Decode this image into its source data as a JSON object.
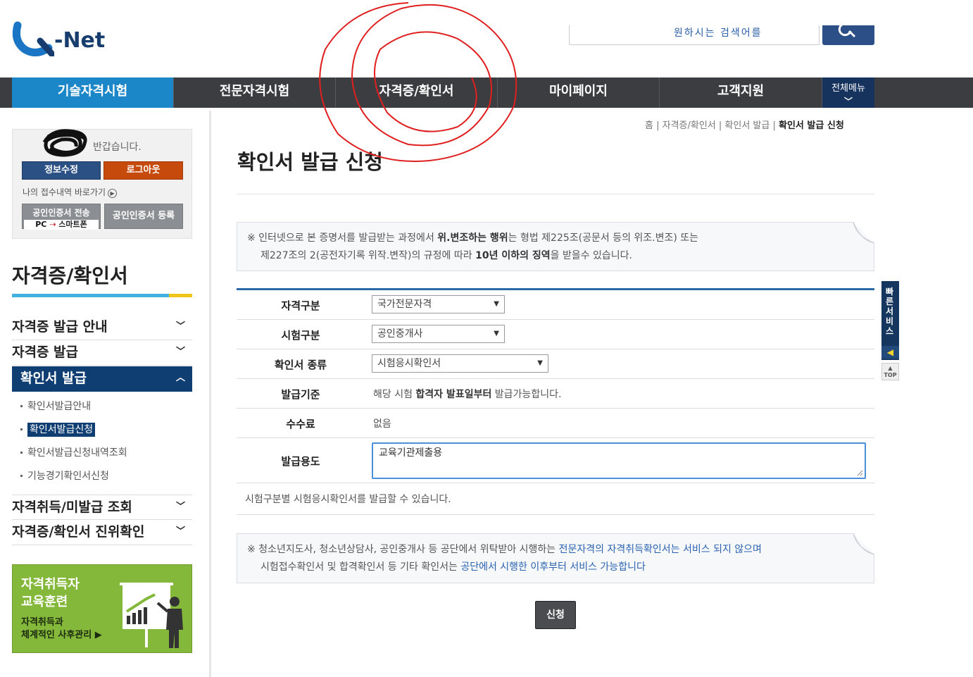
{
  "header": {
    "logo_text": "-Net",
    "search_value": "원하시는 검색어를",
    "gnb": [
      {
        "label": "기술자격시험"
      },
      {
        "label": "전문자격시험"
      },
      {
        "label": "자격증/확인서"
      },
      {
        "label": "마이페이지"
      },
      {
        "label": "고객지원"
      }
    ],
    "all_menu": "전체메뉴"
  },
  "login": {
    "greeting": "반갑습니다.",
    "edit_btn": "정보수정",
    "logout_btn": "로그아웃",
    "my_link": "나의 접수내역 바로가기",
    "cert_transfer_l1": "공인인증서 전송",
    "cert_transfer_pc": "PC",
    "cert_transfer_phone": "스마트폰",
    "cert_register": "공인인증서 등록"
  },
  "lnb": {
    "title": "자격증/확인서",
    "items": [
      {
        "label": "자격증 발급 안내"
      },
      {
        "label": "자격증 발급"
      },
      {
        "label": "확인서 발급"
      },
      {
        "label": "자격취득/미발급 조회"
      },
      {
        "label": "자격증/확인서 진위확인"
      }
    ],
    "sub": [
      {
        "label": "확인서발급안내"
      },
      {
        "label": "확인서발급신청"
      },
      {
        "label": "확인서발급신청내역조회"
      },
      {
        "label": "기능경기확인서신청"
      }
    ],
    "banner": {
      "t1": "자격취득자",
      "t2": "교육훈련",
      "t3": "자격취득과",
      "t4": "체계적인 사후관리"
    }
  },
  "breadcrumb": {
    "home": "홈",
    "b1": "자격증/확인서",
    "b2": "확인서 발급",
    "current": "확인서 발급 신청"
  },
  "page_title": "확인서 발급 신청",
  "notice1": {
    "p1": "※ 인터넷으로 본 증명서를 발급받는 과정에서 ",
    "b1": "위.변조하는 행위",
    "p2": "는 형법 제225조(공문서 등의 위조.변조) 또는",
    "p3": "제227조의 2(공전자기록 위작.변작)의 규정에 따라 ",
    "b2": "10년 이하의 징역",
    "p4": "을 받을수 있습니다."
  },
  "form": {
    "rows": [
      {
        "label": "자격구분",
        "value": "국가전문자격"
      },
      {
        "label": "시험구분",
        "value": "공인중개사"
      },
      {
        "label": "확인서 종류",
        "value": "시험응시확인서"
      },
      {
        "label": "발급기준",
        "pre": "해당 시험 ",
        "bold": "합격자 발표일부터",
        "post": " 발급가능합니다."
      },
      {
        "label": "수수료",
        "value": "없음"
      },
      {
        "label": "발급용도",
        "value": "교육기관제출용"
      }
    ]
  },
  "help_text": "시험구분별 시험응시확인서를 발급할 수 있습니다.",
  "notice2": {
    "p1": "※ 청소년지도사, 청소년상담사, 공인중개사 등 공단에서 위탁받아 시행하는 ",
    "blue1": "전문자격의 자격취득확인서는 서비스 되지 않으며",
    "p2": "시험접수확인서 및 합격확인서 등 기타 확인서는 ",
    "blue2": "공단에서 시행한 이후부터 서비스 가능합니다"
  },
  "submit_label": "신청",
  "quick": {
    "label": "빠른서비스",
    "top": "TOP"
  },
  "colors": {
    "accent": "#1b86c8",
    "navy": "#0f3e73",
    "nav_bg": "#3b3d40"
  }
}
